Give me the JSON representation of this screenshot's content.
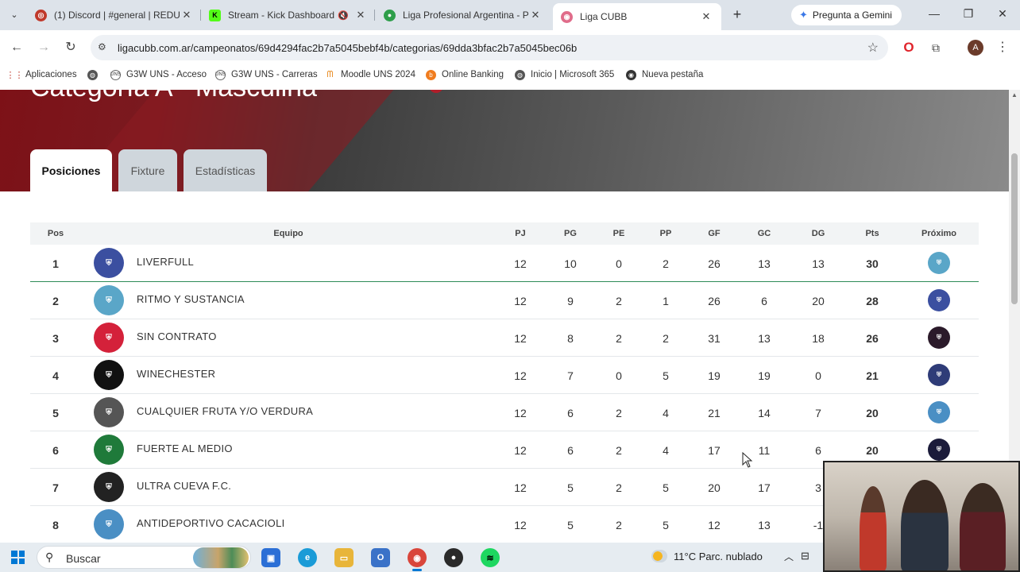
{
  "browser": {
    "tabs": [
      {
        "title": "(1) Discord | #general | REDUC",
        "favicon_color": "#c0392b",
        "favicon_glyph": "◎"
      },
      {
        "title": "Stream - Kick Dashboard",
        "favicon_color": "#53fc18",
        "favicon_glyph": "K"
      },
      {
        "title": "Liga Profesional Argentina - P",
        "favicon_color": "#2e9e4a",
        "favicon_glyph": "⚽"
      },
      {
        "title": "Liga CUBB",
        "favicon_color": "#e06c8a",
        "favicon_glyph": "◉",
        "active": true
      }
    ],
    "gemini_label": "Pregunta a Gemini",
    "url": "ligacubb.com.ar/campeonatos/69d4294fac2b7a5045bebf4b/categorias/69dda3bfac2b7a5045bec06b",
    "profile_initial": "A",
    "bookmarks": [
      {
        "label": "Aplicaciones",
        "icon": "apps-grid-icon"
      },
      {
        "label": "",
        "icon": "globe-icon"
      },
      {
        "label": "G3W UNS - Acceso",
        "icon": "uns-icon"
      },
      {
        "label": "G3W UNS - Carreras",
        "icon": "uns-icon"
      },
      {
        "label": "Moodle UNS 2024",
        "icon": "moodle-icon"
      },
      {
        "label": "Online Banking",
        "icon": "bank-icon"
      },
      {
        "label": "Inicio | Microsoft 365",
        "icon": "globe-icon"
      },
      {
        "label": "Nueva pestaña",
        "icon": "chrome-icon"
      }
    ]
  },
  "page": {
    "hero_title": "Categoría A - Masculina",
    "tabs": [
      {
        "label": "Posiciones",
        "active": true
      },
      {
        "label": "Fixture",
        "active": false
      },
      {
        "label": "Estadísticas",
        "active": false
      }
    ],
    "table": {
      "headers": {
        "pos": "Pos",
        "team": "Equipo",
        "pj": "PJ",
        "pg": "PG",
        "pe": "PE",
        "pp": "PP",
        "gf": "GF",
        "gc": "GC",
        "dg": "DG",
        "pts": "Pts",
        "next": "Próximo"
      },
      "rows": [
        {
          "pos": "1",
          "team": "LIVERFULL",
          "pj": "12",
          "pg": "10",
          "pe": "0",
          "pp": "2",
          "gf": "26",
          "gc": "13",
          "dg": "13",
          "pts": "30",
          "logo_color": "#3b4fa0",
          "next_color": "#5aa6c8"
        },
        {
          "pos": "2",
          "team": "RITMO Y SUSTANCIA",
          "pj": "12",
          "pg": "9",
          "pe": "2",
          "pp": "1",
          "gf": "26",
          "gc": "6",
          "dg": "20",
          "pts": "28",
          "logo_color": "#5aa6c8",
          "next_color": "#3b4fa0"
        },
        {
          "pos": "3",
          "team": "SIN CONTRATO",
          "pj": "12",
          "pg": "8",
          "pe": "2",
          "pp": "2",
          "gf": "31",
          "gc": "13",
          "dg": "18",
          "pts": "26",
          "logo_color": "#d4213a",
          "next_color": "#2b1a2a"
        },
        {
          "pos": "4",
          "team": "WINECHESTER",
          "pj": "12",
          "pg": "7",
          "pe": "0",
          "pp": "5",
          "gf": "19",
          "gc": "19",
          "dg": "0",
          "pts": "21",
          "logo_color": "#111111",
          "next_color": "#2f3c78"
        },
        {
          "pos": "5",
          "team": "CUALQUIER FRUTA Y/O VERDURA",
          "pj": "12",
          "pg": "6",
          "pe": "2",
          "pp": "4",
          "gf": "21",
          "gc": "14",
          "dg": "7",
          "pts": "20",
          "logo_color": "#555555",
          "next_color": "#4a8fc4"
        },
        {
          "pos": "6",
          "team": "FUERTE AL MEDIO",
          "pj": "12",
          "pg": "6",
          "pe": "2",
          "pp": "4",
          "gf": "17",
          "gc": "11",
          "dg": "6",
          "pts": "20",
          "logo_color": "#1f7a3a",
          "next_color": "#1b1b3a"
        },
        {
          "pos": "7",
          "team": "ULTRA CUEVA F.C.",
          "pj": "12",
          "pg": "5",
          "pe": "2",
          "pp": "5",
          "gf": "20",
          "gc": "17",
          "dg": "3",
          "pts": "",
          "logo_color": "#222222",
          "next_color": ""
        },
        {
          "pos": "8",
          "team": "ANTIDEPORTIVO CACACIOLI",
          "pj": "12",
          "pg": "5",
          "pe": "2",
          "pp": "5",
          "gf": "12",
          "gc": "13",
          "dg": "-1",
          "pts": "",
          "logo_color": "#4a8fc4",
          "next_color": ""
        }
      ]
    }
  },
  "taskbar": {
    "search_placeholder": "Buscar",
    "weather": "11°C  Parc. nublado",
    "apps": [
      {
        "name": "store",
        "color": "#2b6fd6"
      },
      {
        "name": "edge",
        "color": "#1a9bd7"
      },
      {
        "name": "explorer",
        "color": "#e8b53a"
      },
      {
        "name": "outlook",
        "color": "#3a72c8"
      },
      {
        "name": "chrome",
        "color": "#d9463b"
      },
      {
        "name": "obs",
        "color": "#2a2a2a"
      },
      {
        "name": "spotify",
        "color": "#1ed760"
      }
    ]
  }
}
